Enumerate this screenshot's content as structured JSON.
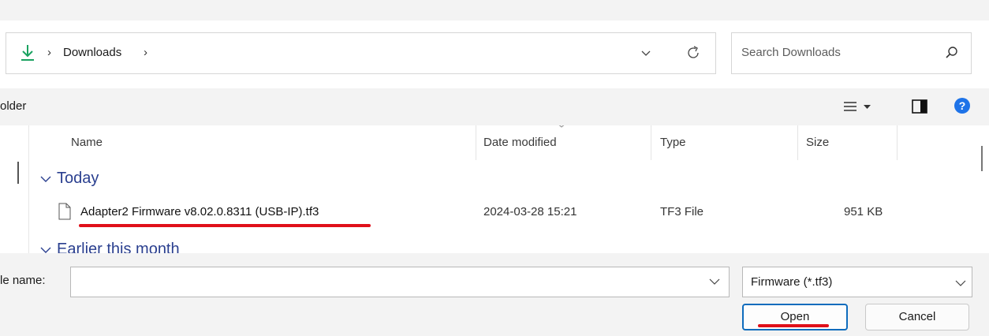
{
  "address_bar": {
    "breadcrumb": [
      "Downloads"
    ],
    "separator": "›"
  },
  "search": {
    "placeholder": "Search Downloads"
  },
  "toolbar": {
    "new_folder_label": "older"
  },
  "file_list": {
    "columns": [
      "Name",
      "Date modified",
      "Type",
      "Size"
    ],
    "groups": [
      {
        "label": "Today",
        "files": [
          {
            "name": "Adapter2 Firmware v8.02.0.8311 (USB-IP).tf3",
            "date_modified": "2024-03-28 15:21",
            "type": "TF3 File",
            "size": "951 KB"
          }
        ]
      },
      {
        "label": "Earlier this month",
        "files": []
      }
    ]
  },
  "bottom": {
    "file_name_label": "le name:",
    "file_name_value": "",
    "filter_value": "Firmware (*.tf3)",
    "open_label": "Open",
    "cancel_label": "Cancel"
  },
  "colors": {
    "accent": "#0f6cbd",
    "download_green": "#1aa260",
    "help_blue": "#1e73e8",
    "annotation_red": "#e0101a",
    "group_blue": "#2a3f8f"
  },
  "icons": [
    "download-icon",
    "chevron-right-icon",
    "chevron-down-icon",
    "refresh-icon",
    "search-icon",
    "view-menu-icon",
    "preview-pane-icon",
    "help-icon",
    "file-icon"
  ]
}
